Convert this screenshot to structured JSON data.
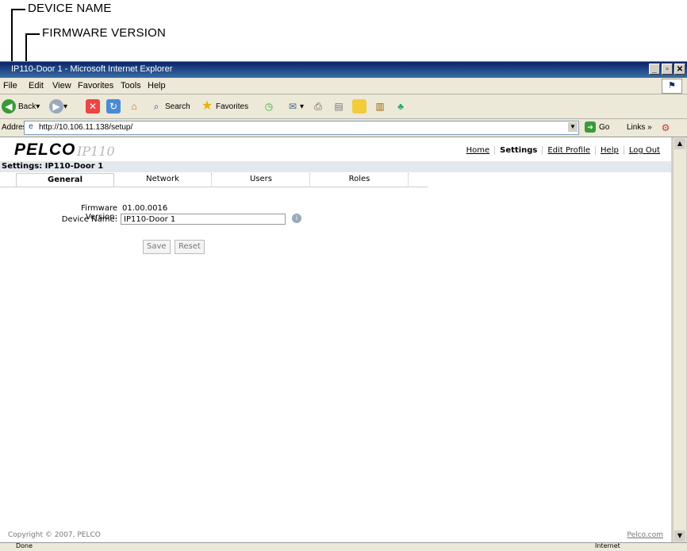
{
  "callouts": {
    "device_name": "DEVICE NAME",
    "firmware_version": "FIRMWARE VERSION"
  },
  "browser": {
    "title": "IP110-Door 1 - Microsoft Internet Explorer",
    "menu": [
      "File",
      "Edit",
      "View",
      "Favorites",
      "Tools",
      "Help"
    ],
    "toolbar": {
      "back": "Back",
      "search": "Search",
      "favorites": "Favorites"
    },
    "address_label": "Address",
    "url": "http://10.106.11.138/setup/",
    "go": "Go",
    "links": "Links",
    "status_text": "Done",
    "zone_text": "Internet"
  },
  "page": {
    "logo": "PELCO",
    "model": "IP110",
    "nav": [
      {
        "label": "Home"
      },
      {
        "label": "Settings"
      },
      {
        "label": "Edit Profile"
      },
      {
        "label": "Help"
      },
      {
        "label": "Log Out"
      }
    ],
    "header": "Settings: IP110-Door 1",
    "tabs": [
      {
        "label": "General"
      },
      {
        "label": "Network"
      },
      {
        "label": "Users"
      },
      {
        "label": "Roles"
      }
    ],
    "firmware_label": "Firmware Version:",
    "firmware_value": "01.00.0016",
    "device_label": "Device Name:",
    "device_value": "IP110-Door 1",
    "save": "Save",
    "reset": "Reset",
    "copyright": "Copyright © 2007, PELCO",
    "footer_link": "Pelco.com"
  }
}
